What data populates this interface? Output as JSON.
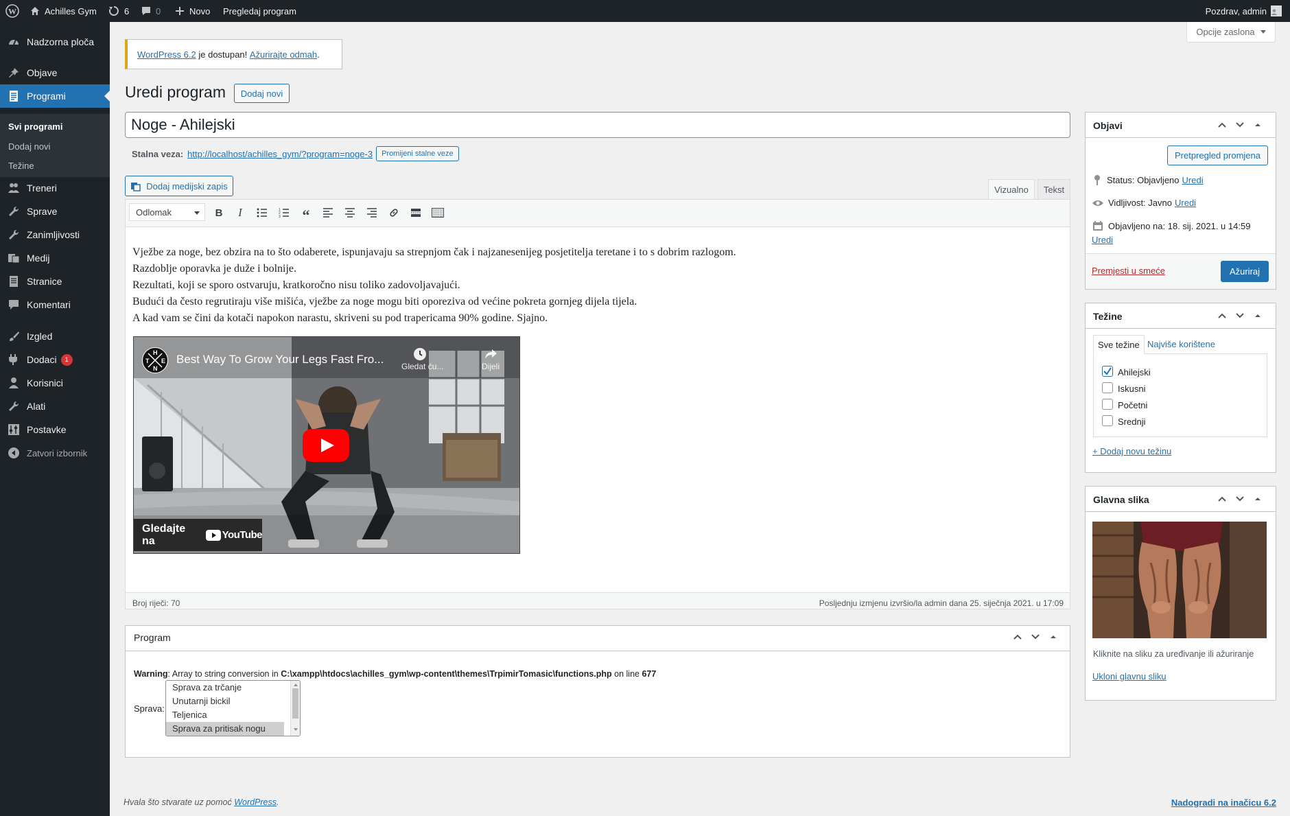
{
  "adminbar": {
    "site_name": "Achilles Gym",
    "updates_count": "6",
    "comments_count": "0",
    "new_label": "Novo",
    "view_label": "Pregledaj program",
    "greeting": "Pozdrav, admin"
  },
  "sidebar": {
    "items": [
      {
        "label": "Nadzorna ploča",
        "icon": "dashboard-icon"
      },
      {
        "label": "Objave",
        "icon": "pin-icon"
      },
      {
        "label": "Programi",
        "icon": "page-icon"
      },
      {
        "label": "Treneri",
        "icon": "people-icon"
      },
      {
        "label": "Sprave",
        "icon": "wrench-icon"
      },
      {
        "label": "Zanimljivosti",
        "icon": "wrench-icon"
      },
      {
        "label": "Medij",
        "icon": "media-icon"
      },
      {
        "label": "Stranice",
        "icon": "page-icon"
      },
      {
        "label": "Komentari",
        "icon": "comment-icon"
      },
      {
        "label": "Izgled",
        "icon": "brush-icon"
      },
      {
        "label": "Dodaci",
        "icon": "plugin-icon",
        "badge": "1"
      },
      {
        "label": "Korisnici",
        "icon": "user-icon"
      },
      {
        "label": "Alati",
        "icon": "tools-icon"
      },
      {
        "label": "Postavke",
        "icon": "settings-icon"
      },
      {
        "label": "Zatvori izbornik",
        "icon": "collapse-icon"
      }
    ],
    "submenu": [
      "Svi programi",
      "Dodaj novi",
      "Težine"
    ]
  },
  "screen_options": "Opcije zaslona",
  "notice": {
    "link1": "WordPress 6.2",
    "middle": " je dostupan! ",
    "link2": "Ažurirajte odmah",
    "end": "."
  },
  "page_title": "Uredi program",
  "add_new": "Dodaj novi",
  "post_title": "Noge - Ahilejski",
  "permalink": {
    "label": "Stalna veza:",
    "url": "http://localhost/achilles_gym/?program=noge-3",
    "change_btn": "Promijeni stalne veze"
  },
  "add_media": "Dodaj medijski zapis",
  "editor_tabs": {
    "visual": "Vizualno",
    "text": "Tekst"
  },
  "format_select": "Odlomak",
  "content_lines": [
    "Vježbe za noge, bez obzira na to što odaberete, ispunjavaju sa strepnjom čak i najzanesenijeg posjetitelja teretane i to s dobrim razlogom.",
    "Razdoblje oporavka je duže i bolnije.",
    "Rezultati, koji se sporo ostvaruju, kratkoročno nisu toliko zadovoljavajući.",
    "Budući da često regrutiraju više mišića, vježbe za noge mogu biti oporeziva od većine pokreta gornjeg dijela tijela.",
    "A kad vam se čini da kotači napokon narastu, skriveni su pod trapericama 90% godine. Sjajno."
  ],
  "video": {
    "title": "Best Way To Grow Your Legs Fast Fro...",
    "watch_later": "Gledat ću...",
    "share": "Dijeli",
    "watch_on": "Gledajte na",
    "youtube": "YouTube",
    "logo_letters": [
      "H",
      "T",
      "E",
      "N"
    ]
  },
  "word_count": "Broj riječi: 70",
  "last_edit": "Posljednju izmjenu izvršio/la admin dana 25. siječnja 2021. u 17:09",
  "program_box": {
    "title": "Program",
    "warning_label": "Warning",
    "warning_text": ": Array to string conversion in ",
    "warning_path": "C:\\xampp\\htdocs\\achilles_gym\\wp-content\\themes\\TrpimirTomasic\\functions.php",
    "warning_on": " on line ",
    "warning_line": "677",
    "sprava_label": "Sprava:",
    "options": [
      "Sprava za trčanje",
      "Unutarnji bickil",
      "Teljenica",
      "Sprava za pritisak nogu"
    ]
  },
  "publish": {
    "title": "Objavi",
    "preview": "Pretpregled promjena",
    "status_label": "Status: ",
    "status_value": "Objavljeno",
    "visibility_label": "Vidljivost: ",
    "visibility_value": "Javno",
    "published_label": "Objavljeno na: ",
    "published_value": "18. sij. 2021. u 14:59",
    "edit": "Uredi",
    "trash": "Premjesti u smeće",
    "update": "Ažuriraj"
  },
  "tezine": {
    "title": "Težine",
    "tab_all": "Sve težine",
    "tab_popular": "Najviše korištene",
    "items": [
      {
        "label": "Ahilejski",
        "checked": true
      },
      {
        "label": "Iskusni",
        "checked": false
      },
      {
        "label": "Početni",
        "checked": false
      },
      {
        "label": "Srednji",
        "checked": false
      }
    ],
    "add_new": "+ Dodaj novu težinu"
  },
  "featured": {
    "title": "Glavna slika",
    "hint": "Kliknite na sliku za uređivanje ili ažuriranje",
    "remove": "Ukloni glavnu sliku"
  },
  "footer": {
    "thanks": "Hvala što stvarate uz pomoć ",
    "wp": "WordPress",
    "thanks_end": ".",
    "upgrade": "Nadogradi na inačicu 6.2"
  },
  "colors": {
    "primary": "#2271b1",
    "sidebar_bg": "#1d2327",
    "notice_border": "#dba617",
    "danger": "#b32d2e"
  }
}
